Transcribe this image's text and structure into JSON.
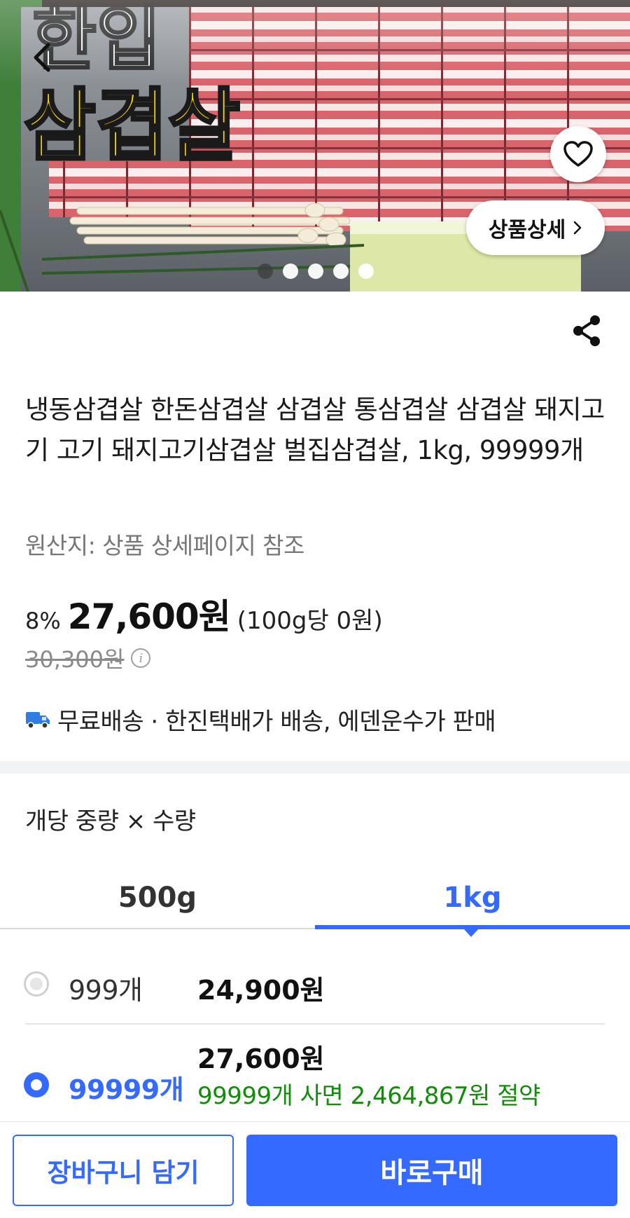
{
  "hero": {
    "image_text_line1": "한입",
    "image_text_line2": "삼겹살",
    "detail_button_label": "상품상세",
    "slide_count": 5,
    "active_slide": 1
  },
  "product": {
    "title": "냉동삼겹살 한돈삼겹살 삼겹살 통삼겹살 삼겹살 돼지고기 고기 돼지고기삼겹살 벌집삼겹살, 1kg, 99999개",
    "origin": "원산지: 상품 상세페이지 참조",
    "discount": "8%",
    "price": "27,600원",
    "unit_price": "(100g당 0원)",
    "original_price": "30,300원",
    "info_icon_glyph": "i",
    "shipping": "무료배송 · 한진택배가 배송, 에덴운수가 판매"
  },
  "options": {
    "label": "개당 중량 × 수량",
    "tabs": [
      {
        "label": "500g",
        "selected": false
      },
      {
        "label": "1kg",
        "selected": true
      }
    ],
    "rows": [
      {
        "quantity": "999개",
        "price": "24,900원",
        "selected": false
      },
      {
        "quantity": "99999개",
        "price": "27,600원",
        "saving": "99999개 사면 2,464,867원 절약",
        "selected": true
      }
    ]
  },
  "bottom_bar": {
    "cart_label": "장바구니 담기",
    "buy_label": "바로구매"
  },
  "colors": {
    "accent": "#346aff",
    "saving_green": "#128c0a",
    "hero_banner_yellow": "#ffd500"
  }
}
